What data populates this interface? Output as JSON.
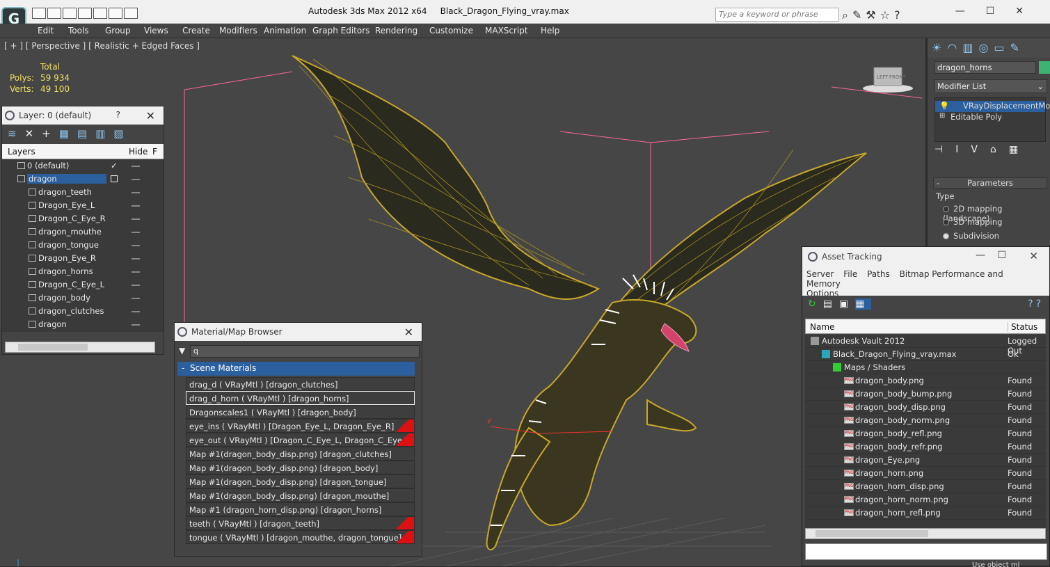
{
  "app": {
    "title": "Autodesk 3ds Max  2012 x64",
    "file": "Black_Dragon_Flying_vray.max",
    "search_placeholder": "Type a keyword or phrase"
  },
  "menu": [
    "Edit",
    "Tools",
    "Group",
    "Views",
    "Create",
    "Modifiers",
    "Animation",
    "Graph Editors",
    "Rendering",
    "Customize",
    "MAXScript",
    "Help"
  ],
  "viewport": {
    "label": "[ + ] [ Perspective ] [ Realistic + Edged Faces ]",
    "stats_total": "Total",
    "polys_label": "Polys:",
    "polys_value": "59 934",
    "verts_label": "Verts:",
    "verts_value": "49 100",
    "cube_labels": [
      "LEFT",
      "FRONT"
    ],
    "y_label": "y",
    "x_label": "x"
  },
  "layer_panel": {
    "title": "Layer: 0 (default)",
    "help": "?",
    "col_layers": "Layers",
    "col_hide": "Hide",
    "col_f": "F",
    "rows": [
      {
        "name": "0 (default)",
        "level": 0
      },
      {
        "name": "dragon",
        "level": 0
      },
      {
        "name": "dragon_teeth",
        "level": 1
      },
      {
        "name": "Dragon_Eye_L",
        "level": 1
      },
      {
        "name": "Dragon_C_Eye_R",
        "level": 1
      },
      {
        "name": "dragon_mouthe",
        "level": 1
      },
      {
        "name": "dragon_tongue",
        "level": 1
      },
      {
        "name": "Dragon_Eye_R",
        "level": 1
      },
      {
        "name": "dragon_horns",
        "level": 1
      },
      {
        "name": "Dragon_C_Eye_L",
        "level": 1
      },
      {
        "name": "dragon_body",
        "level": 1
      },
      {
        "name": "dragon_clutches",
        "level": 1
      },
      {
        "name": "dragon",
        "level": 1
      }
    ]
  },
  "material_browser": {
    "title": "Material/Map Browser",
    "search_value": "q",
    "section": "Scene Materials",
    "items": [
      "drag_d  ( VRayMtl ) [dragon_clutches]",
      "drag_d_horn  ( VRayMtl ) [dragon_horns]",
      "Dragonscales1  ( VRayMtl ) [dragon_body]",
      "eye_ins  ( VRayMtl ) [Dragon_Eye_L, Dragon_Eye_R]",
      "eye_out  ( VRayMtl ) [Dragon_C_Eye_L, Dragon_C_Eye_R]",
      "Map #1(dragon_body_disp.png) [dragon_clutches]",
      "Map #1(dragon_body_disp.png) [dragon_body]",
      "Map #1(dragon_body_disp.png) [dragon_tongue]",
      "Map #1(dragon_body_disp.png) [dragon_mouthe]",
      "Map #1 (dragon_horn_disp.png) [dragon_horns]",
      "teeth  ( VRayMtl ) [dragon_teeth]",
      "tongue  ( VRayMtl ) [dragon_mouthe, dragon_tongue]"
    ]
  },
  "command_panel": {
    "object_name": "dragon_horns",
    "modifier_list": "Modifier List",
    "modifiers": [
      "VRayDisplacementMod",
      "Editable Poly"
    ],
    "params_title": "Parameters",
    "type_label": "Type",
    "options": [
      "2D mapping (landscape)",
      "3D mapping",
      "Subdivision"
    ],
    "selected_option": "Subdivision"
  },
  "asset_tracking": {
    "title": "Asset Tracking",
    "menu": [
      "Server",
      "File",
      "Paths",
      "Bitmap Performance and Memory",
      "Options"
    ],
    "col_name": "Name",
    "col_status": "Status",
    "rows": [
      {
        "name": "Autodesk Vault 2012",
        "status": "Logged Out",
        "level": 0,
        "icon": "vault-icon"
      },
      {
        "name": "Black_Dragon_Flying_vray.max",
        "status": "Ok",
        "level": 1,
        "icon": "max-file-icon"
      },
      {
        "name": "Maps / Shaders",
        "status": "",
        "level": 2,
        "icon": "maps-icon"
      },
      {
        "name": "dragon_body.png",
        "status": "Found",
        "level": 3,
        "icon": "png-icon"
      },
      {
        "name": "dragon_body_bump.png",
        "status": "Found",
        "level": 3,
        "icon": "png-icon"
      },
      {
        "name": "dragon_body_disp.png",
        "status": "Found",
        "level": 3,
        "icon": "png-icon"
      },
      {
        "name": "dragon_body_norm.png",
        "status": "Found",
        "level": 3,
        "icon": "png-icon"
      },
      {
        "name": "dragon_body_refl.png",
        "status": "Found",
        "level": 3,
        "icon": "png-icon"
      },
      {
        "name": "dragon_body_refr.png",
        "status": "Found",
        "level": 3,
        "icon": "png-icon"
      },
      {
        "name": "dragon_Eye.png",
        "status": "Found",
        "level": 3,
        "icon": "png-icon"
      },
      {
        "name": "dragon_horn.png",
        "status": "Found",
        "level": 3,
        "icon": "png-icon"
      },
      {
        "name": "dragon_horn_disp.png",
        "status": "Found",
        "level": 3,
        "icon": "png-icon"
      },
      {
        "name": "dragon_horn_norm.png",
        "status": "Found",
        "level": 3,
        "icon": "png-icon"
      },
      {
        "name": "dragon_horn_refl.png",
        "status": "Found",
        "level": 3,
        "icon": "png-icon"
      }
    ],
    "footer_text": "Use object ml"
  },
  "colors": {
    "selection": "#2b5f9e",
    "wire": "#b8a02a",
    "grid": "#ff6699"
  }
}
